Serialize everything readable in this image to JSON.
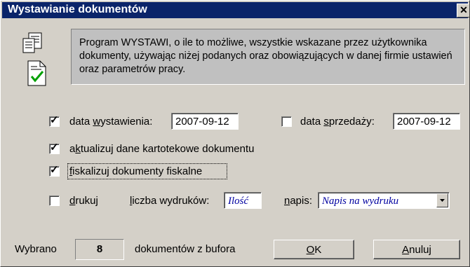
{
  "window": {
    "title": "Wystawianie dokumentów",
    "close_glyph": "✕"
  },
  "info": {
    "text": "Program WYSTAWI, o ile to możliwe, wszystkie wskazane przez użytkownika dokumenty, używając niżej podanych oraz obowiązujących w danej firmie ustawień oraz parametrów pracy.",
    "icons": [
      "documents-stack-icon",
      "document-checkmark-icon"
    ]
  },
  "options": {
    "data_wystawienia": {
      "checked": true,
      "label_pre": "data ",
      "label_u": "w",
      "label_post": "ystawienia:",
      "value": "2007-09-12"
    },
    "data_sprzedazy": {
      "checked": false,
      "label_pre": "data ",
      "label_u": "s",
      "label_post": "przedaży:",
      "value": "2007-09-12"
    },
    "aktualizuj": {
      "checked": true,
      "label_pre": "a",
      "label_u": "k",
      "label_post": "tualizuj dane kartotekowe dokumentu"
    },
    "fiskalizuj": {
      "checked": true,
      "label_pre": "",
      "label_u": "f",
      "label_post": "iskalizuj dokumenty fiskalne"
    },
    "drukuj": {
      "checked": false,
      "label_pre": "",
      "label_u": "d",
      "label_post": "rukuj"
    },
    "liczba_wydrukow": {
      "label_pre": "",
      "label_u": "l",
      "label_post": "iczba wydruków:",
      "value": "Ilość"
    },
    "napis": {
      "label_pre": "",
      "label_u": "n",
      "label_post": "apis:",
      "value": "Napis na wydruku"
    }
  },
  "footer": {
    "wybrano_label": "Wybrano",
    "count": "8",
    "suffix": "dokumentów z bufora",
    "ok_u": "O",
    "ok_post": "K",
    "anuluj_u": "A",
    "anuluj_post": "nuluj"
  },
  "check_glyph": "✓"
}
